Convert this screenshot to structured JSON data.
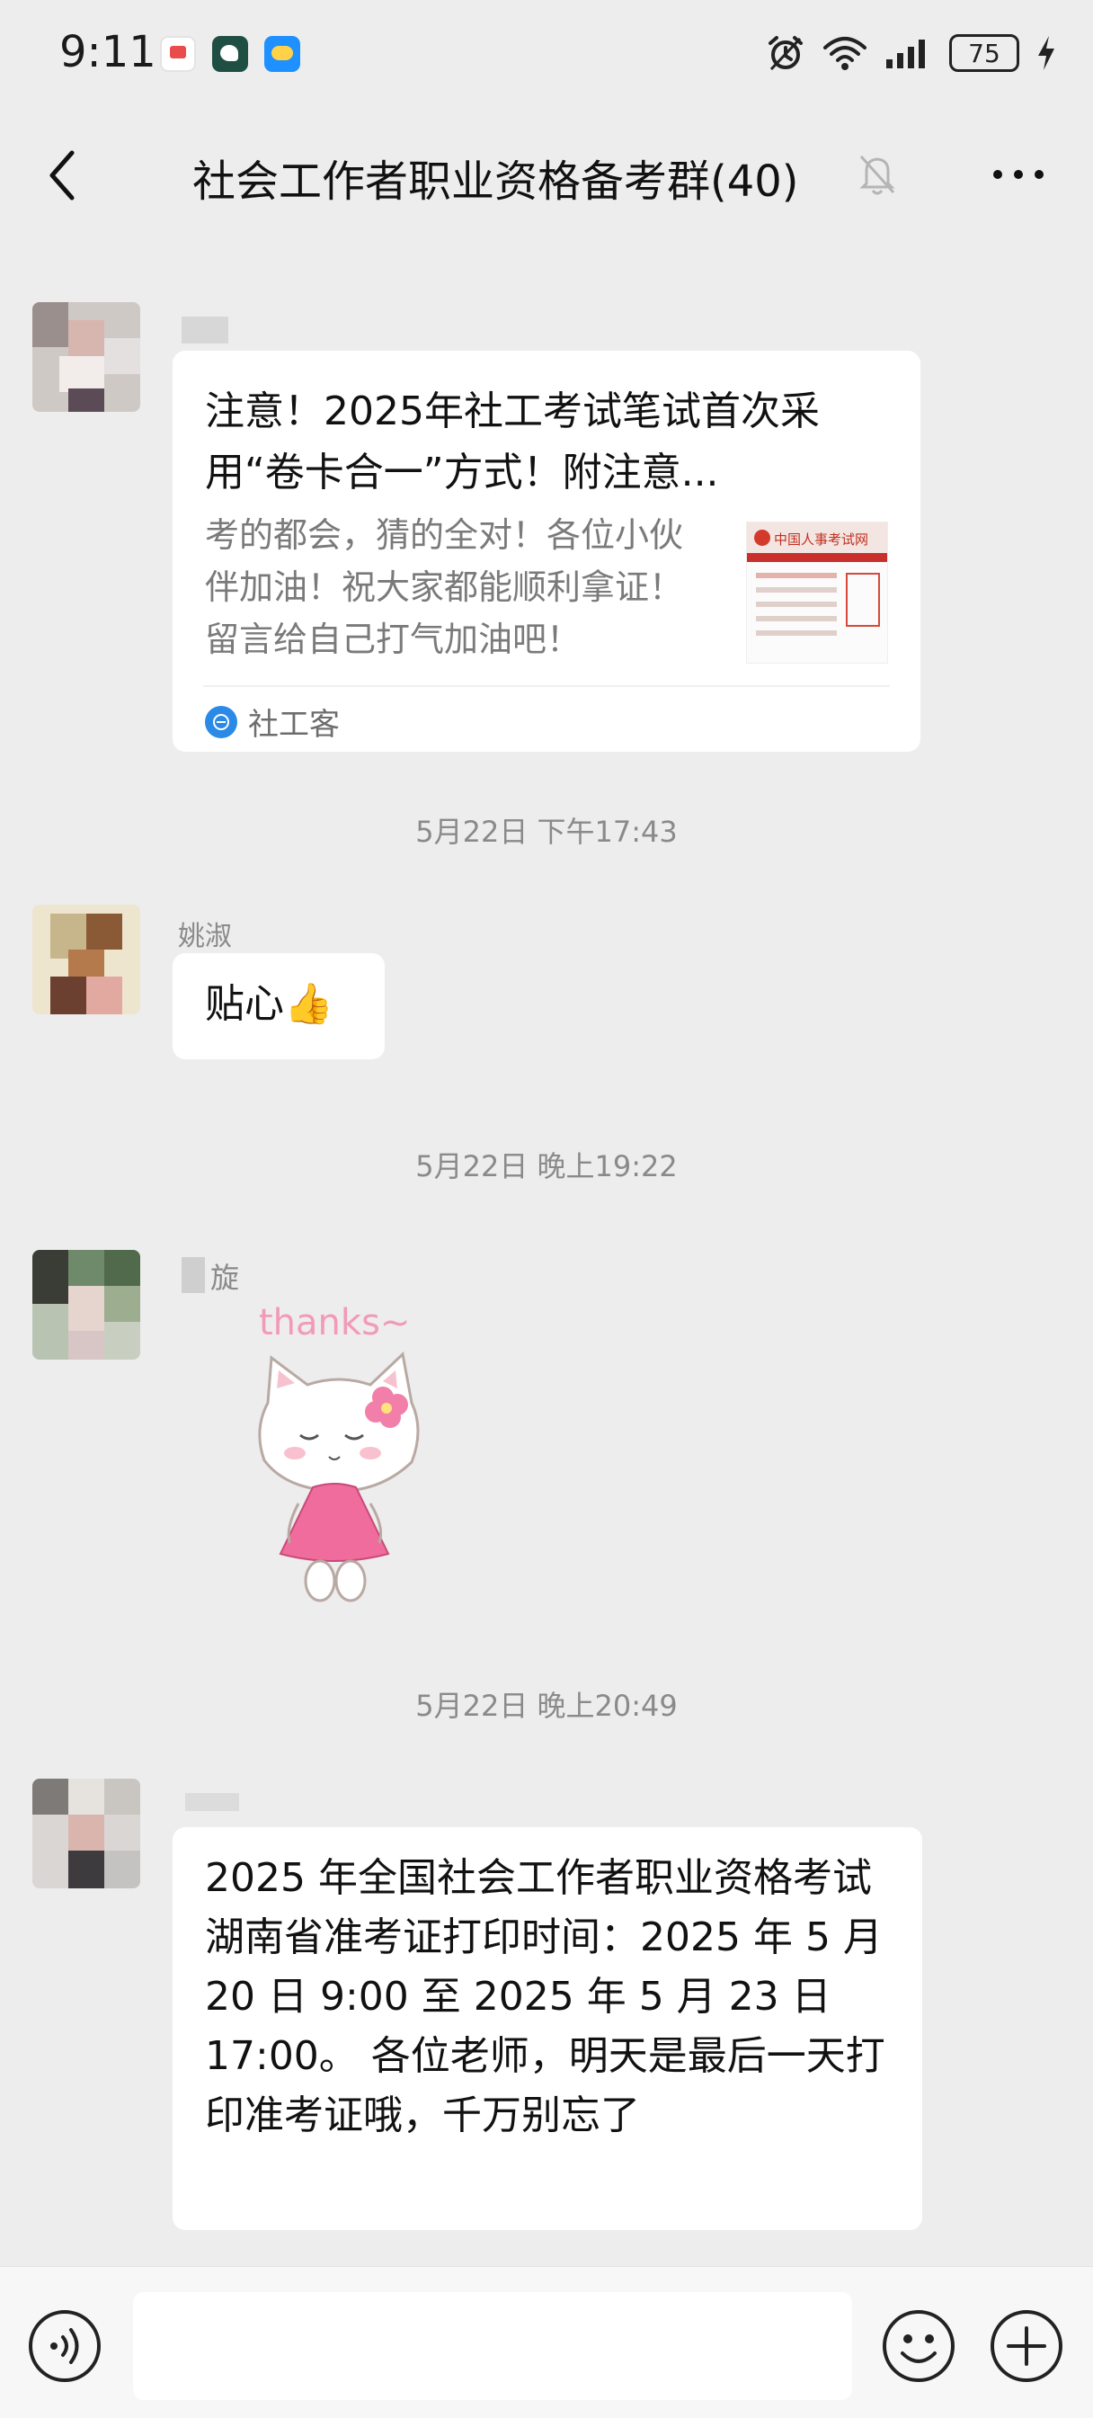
{
  "status_bar": {
    "time": "9:11",
    "battery": "75",
    "icons": [
      "calendar-notification-icon",
      "app-notification-icon",
      "weather-notification-icon",
      "alarm-icon",
      "wifi-icon",
      "signal-icon",
      "battery-icon",
      "charging-icon"
    ]
  },
  "header": {
    "title": "社会工作者职业资格备考群(40)",
    "icons": [
      "back-icon",
      "mute-icon",
      "more-icon"
    ]
  },
  "messages": [
    {
      "type": "link_card",
      "card": {
        "title": "注意！2025年社工考试笔试首次采用“卷卡合一”方式！附注意...",
        "description": "考的都会，猜的全对！各位小伙伴加油！祝大家都能顺利拿证！留言给自己打气加油吧！",
        "source": "社工客",
        "thumbnail_text": "中国人事考试网"
      }
    },
    {
      "type": "timestamp",
      "text": "5月22日 下午17:43"
    },
    {
      "type": "text",
      "sender": "姚淑",
      "text": "贴心👍"
    },
    {
      "type": "timestamp",
      "text": "5月22日 晚上19:22"
    },
    {
      "type": "sticker",
      "sender": "旋",
      "sticker_text": "thanks~",
      "sticker_name": "white-cat-pink-dress"
    },
    {
      "type": "timestamp",
      "text": "5月22日 晚上20:49"
    },
    {
      "type": "text",
      "sender": "",
      "text": "2025 年全国社会工作者职业资格考试湖南省准考证打印时间：2025 年 5 月 20 日 9:00 至 2025 年 5 月 23 日 17:00。 各位老师，明天是最后一天打印准考证哦，千万别忘了"
    }
  ],
  "input_bar": {
    "placeholder": "",
    "icons": [
      "voice-icon",
      "emoji-icon",
      "plus-icon"
    ]
  },
  "colors": {
    "background": "#ededed",
    "bubble": "#ffffff",
    "timestamp_text": "#8a8a8a",
    "link_icon": "#2b8ae6"
  }
}
